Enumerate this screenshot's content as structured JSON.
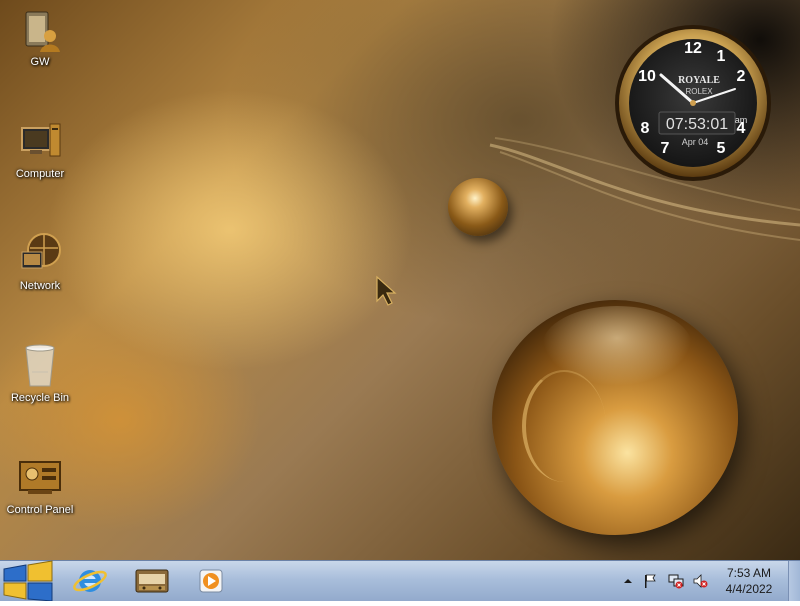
{
  "desktop": {
    "icons": [
      {
        "label": "GW",
        "icon": "user-folder-icon"
      },
      {
        "label": "Computer",
        "icon": "computer-icon"
      },
      {
        "label": "Network",
        "icon": "network-icon"
      },
      {
        "label": "Recycle Bin",
        "icon": "recycle-bin-icon"
      },
      {
        "label": "Control Panel",
        "icon": "control-panel-icon"
      }
    ]
  },
  "clock_gadget": {
    "brand": "ROYALE",
    "brand2": "ROLEX",
    "time": "07:53:01",
    "ampm": "am",
    "date": "Apr 04",
    "numerals": [
      "12",
      "1",
      "2",
      "4",
      "5",
      "7",
      "8",
      "10"
    ]
  },
  "taskbar": {
    "pinned": [
      {
        "name": "internet-explorer",
        "icon": "internet-explorer-icon"
      },
      {
        "name": "file-explorer",
        "icon": "file-explorer-icon"
      },
      {
        "name": "media-player",
        "icon": "media-player-icon"
      }
    ],
    "tray": {
      "time": "7:53 AM",
      "date": "4/4/2022"
    }
  },
  "colors": {
    "taskbar": "#a9bedb",
    "desktop_accent": "#b88a45",
    "clock_face": "#1e1e1e"
  }
}
